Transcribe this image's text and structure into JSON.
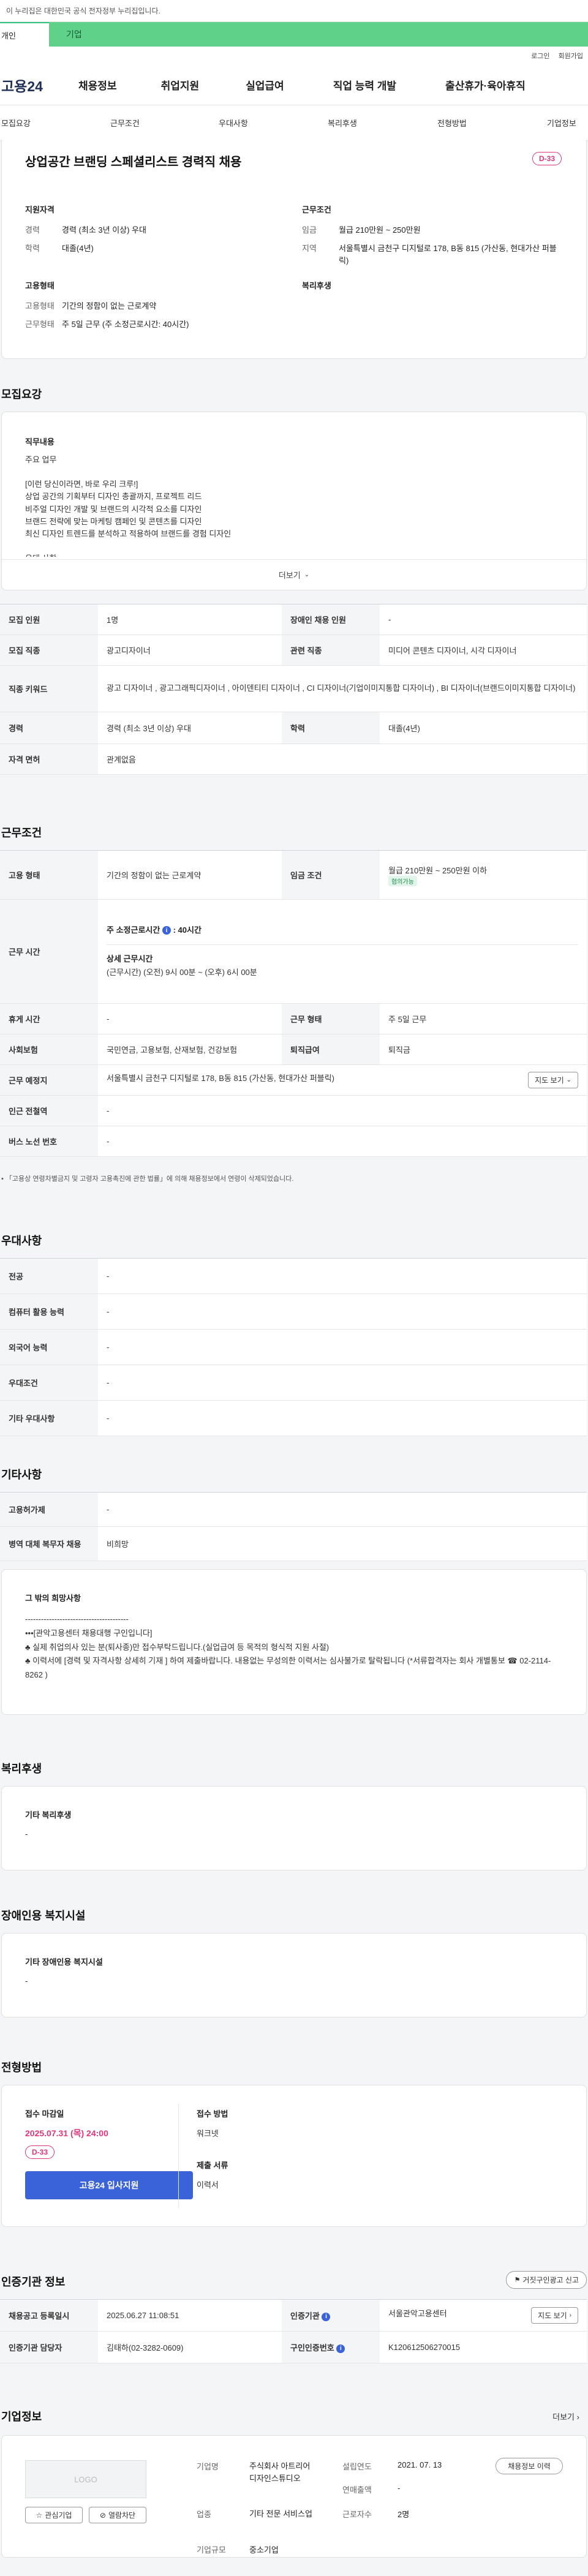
{
  "gov_notice": "이 누리집은 대한민국 공식 전자정부 누리집입니다.",
  "user_tabs": {
    "personal": "개인",
    "company": "기업"
  },
  "util": {
    "login": "로그인",
    "signup": "회원가입"
  },
  "logo": "고용24",
  "gnb": [
    "채용정보",
    "취업지원",
    "실업급여",
    "직업 능력 개발",
    "출산휴가·육아휴직"
  ],
  "subnav": [
    "모집요강",
    "근무조건",
    "우대사항",
    "복리후생",
    "전형방법",
    "기업정보"
  ],
  "job": {
    "title": "상업공간 브랜딩 스페셜리스트 경력직 채용",
    "dday": "D-33",
    "qual_head": "지원자격",
    "career_k": "경력",
    "career_v": "경력 (최소 3년 이상) 우대",
    "edu_k": "학력",
    "edu_v": "대졸(4년)",
    "emp_head": "고용형태",
    "emptype_k": "고용형태",
    "emptype_v": "기간의 정함이 없는 근로계약",
    "worktype_k": "근무형태",
    "worktype_v": "주 5일 근무 (주 소정근로시간: 40시간)",
    "cond_head": "근무조건",
    "wage_k": "임금",
    "wage_v": "월급 210만원 ~ 250만원",
    "region_k": "지역",
    "region_v": "서울특별시 금천구 디지털로 178, B동 815 (가산동, 현대가산 퍼블릭)",
    "welfare_head": "복리후생"
  },
  "recruit": {
    "title": "모집요강",
    "duty_head": "직무내용",
    "duty_body": "주요 업무\n\n[이런 당신이라면, 바로 우리 크루!]\n상업 공간의 기획부터 디자인 총괄까지, 프로젝트 리드\n비주얼 디자인 개발 및 브랜드의 시각적 요소를 디자인\n브랜드 전략에 맞는 마케팅 캠페인 및 콘텐츠를 디자인\n최신 디자인 트렌드를 분석하고 적용하여 브랜드를 경험 디자인\n\n우대 사항",
    "more": "더보기",
    "rows": [
      {
        "k1": "모집 인원",
        "v1": "1명",
        "k2": "장애인 채용 인원",
        "v2": "-"
      },
      {
        "k1": "모집 직종",
        "v1": "광고디자이너",
        "k2": "관련 직종",
        "v2": "미디어 콘텐츠 디자이너, 시각 디자이너"
      },
      {
        "k1": "직종 키워드",
        "v1": "광고 디자이너 , 광고그래픽디자이너 , 아이덴티티 디자이너 , CI 디자이너(기업이미지통합 디자이너) , BI 디자이너(브랜드이미지통합 디자이너)"
      },
      {
        "k1": "경력",
        "v1": "경력 (최소 3년 이상) 우대",
        "k2": "학력",
        "v2": "대졸(4년)"
      },
      {
        "k1": "자격 면허",
        "v1": "관계없음"
      }
    ]
  },
  "work": {
    "title": "근무조건",
    "emptype_k": "고용 형태",
    "emptype_v": "기간의 정함이 없는 근로계약",
    "wage_k": "임금 조건",
    "wage_v": "월급 210만원 ~ 250만원 이하",
    "wage_badge": "협의가능",
    "hours_k": "근무 시간",
    "hours_main": "주 소정근로시간",
    "hours_main_v": ": 40시간",
    "hours_detail_head": "상세 근무시간",
    "hours_detail_v": "(근무시간) (오전) 9시 00분 ~ (오후) 6시 00분",
    "rest_k": "휴게 시간",
    "rest_v": "-",
    "worktype_k": "근무 형태",
    "worktype_v": "주 5일 근무",
    "insurance_k": "사회보험",
    "insurance_v": "국민연금, 고용보험, 산재보험, 건강보험",
    "severance_k": "퇴직급여",
    "severance_v": "퇴직금",
    "place_k": "근무 예정지",
    "place_v": "서울특별시 금천구 디지털로 178, B동 815 (가산동, 현대가산 퍼블릭)",
    "map_btn": "지도 보기",
    "subway_k": "인근 전철역",
    "subway_v": "-",
    "bus_k": "버스 노선 번호",
    "bus_v": "-",
    "note": "「고용상 연령차별금지 및 고령자 고용촉진에 관한 법률」에 의해 채용정보에서 연령이 삭제되었습니다."
  },
  "pref": {
    "title": "우대사항",
    "rows": [
      {
        "k": "전공",
        "v": "-"
      },
      {
        "k": "컴퓨터 활용 능력",
        "v": "-"
      },
      {
        "k": "외국어 능력",
        "v": "-"
      },
      {
        "k": "우대조건",
        "v": "-"
      },
      {
        "k": "기타 우대사항",
        "v": "-"
      }
    ]
  },
  "etc": {
    "title": "기타사항",
    "rows": [
      {
        "k": "고용허가제",
        "v": "-"
      },
      {
        "k": "병역 대체 복무자 채용",
        "v": "비희망"
      }
    ],
    "wish_head": "그 밖의 희망사항",
    "wish_body": "---------------------------------------\n•••[관악고용센터 채용대행 구인입니다]\n♣ 실제 취업의사 있는 분(퇴사종)만 접수부탁드립니다.(실업급여 등 목적의 형식적 지원 사절)\n♣ 이력서에 [경력 및 자격사항 상세히 기재 ] 하여 제출바랍니다. 내용없는 무성의한 이력서는 심사불가로 탈락됩니다 (*서류합격자는 회사 개별통보 ☎ 02-2114-8262 )"
  },
  "welfare": {
    "title": "복리후생",
    "head": "기타 복리후생",
    "body": "-"
  },
  "disab": {
    "title": "장애인용 복지시설",
    "head": "기타 장애인용 복지시설",
    "body": "-"
  },
  "screen": {
    "title": "전형방법",
    "deadline_head": "접수 마감일",
    "deadline_v": "2025.07.31 (목) 24:00",
    "dday": "D-33",
    "apply_btn": "고용24 입사지원",
    "method_head": "접수 방법",
    "method_v": "워크넷",
    "docs_head": "제출 서류",
    "docs_v": "이력서"
  },
  "cert": {
    "title": "인증기관 정보",
    "report_btn": "거짓구인광고 신고",
    "regdate_k": "채용공고 등록일시",
    "regdate_v": "2025.06.27 11:08:51",
    "agency_k": "인증기관",
    "agency_v": "서울관악고용센터",
    "map_btn": "지도 보기",
    "manager_k": "인증기관 담당자",
    "manager_v": "김태하(02-3282-0609)",
    "reqno_k": "구인인증번호",
    "reqno_v": "K120612506270015"
  },
  "company": {
    "title": "기업정보",
    "more": "더보기",
    "logo": "LOGO",
    "fav_btn": "관심기업",
    "block_btn": "열람차단",
    "name_k": "기업명",
    "name_v": "주식회사 아트리어디자인스튜디오",
    "founded_k": "설립연도",
    "founded_v": "2021. 07. 13",
    "sales_k": "연매출액",
    "sales_v": "-",
    "industry_k": "업종",
    "industry_v": "기타 전문 서비스업",
    "staff_k": "근로자수",
    "staff_v": "2명",
    "size_k": "기업규모",
    "size_v": "중소기업",
    "jobs_btn": "채용정보 이력"
  }
}
